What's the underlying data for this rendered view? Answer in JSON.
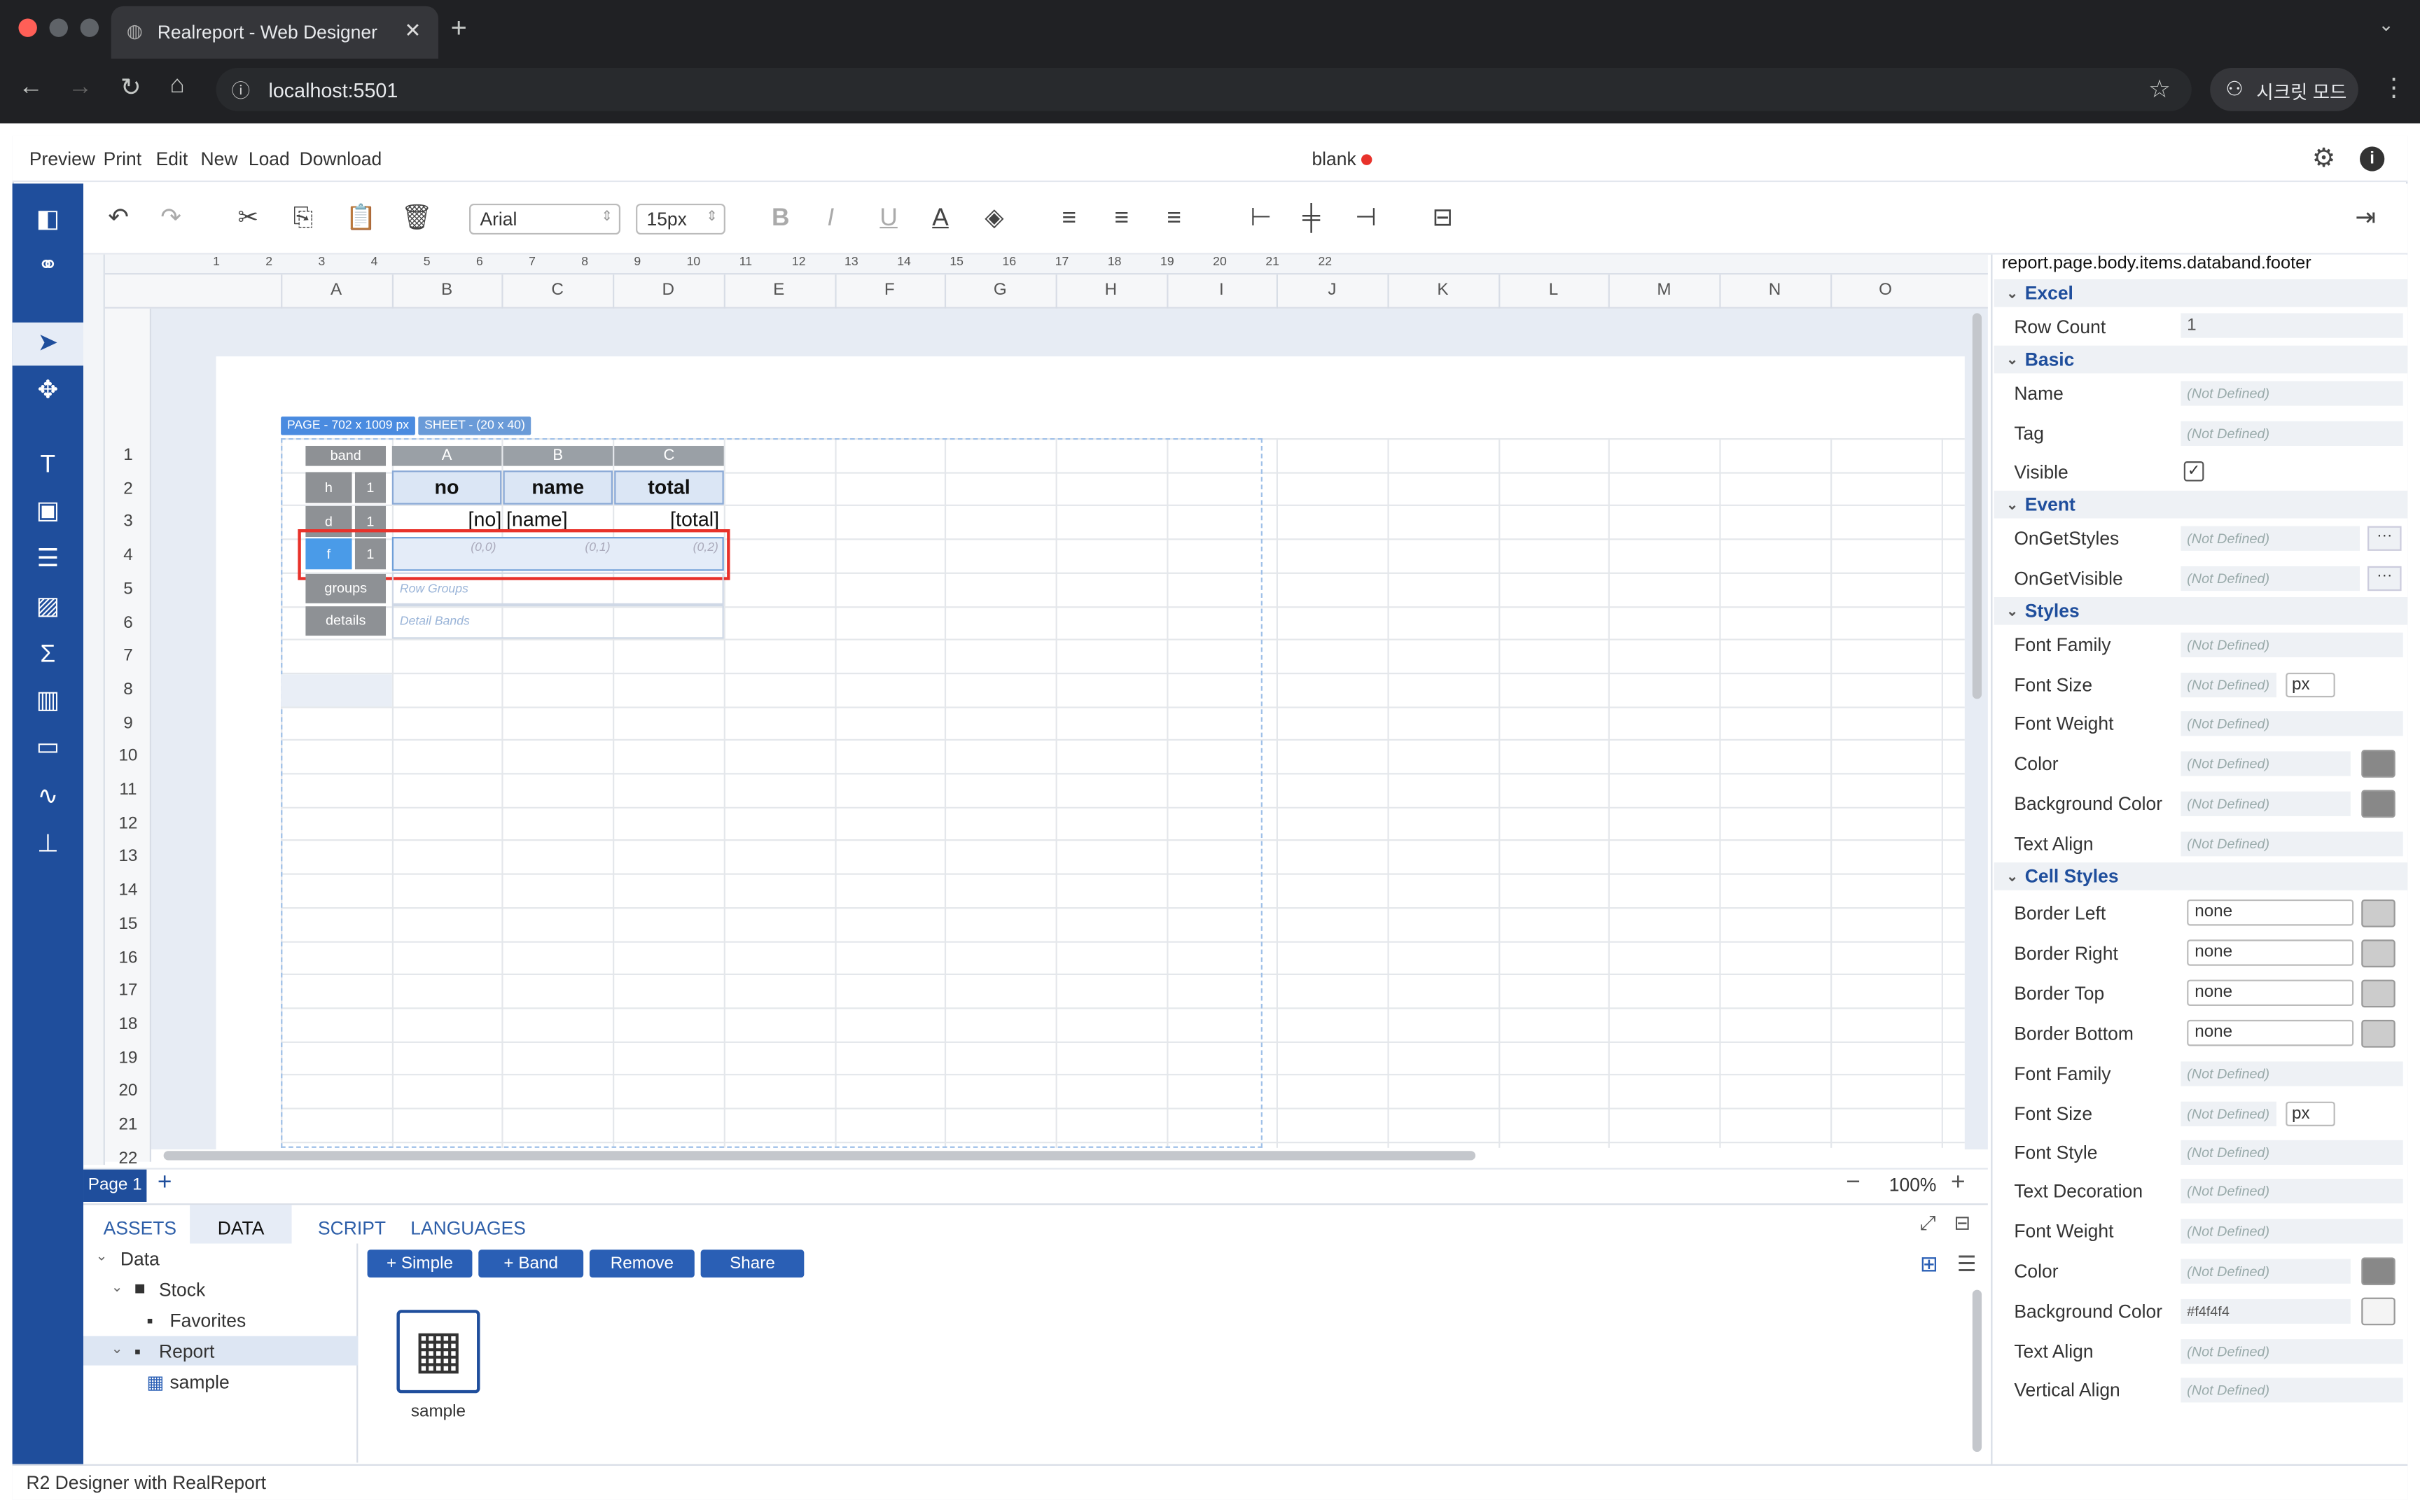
{
  "browser": {
    "tab_title": "Realreport - Web Designer",
    "url": "localhost:5501",
    "incognito_label": "시크릿 모드"
  },
  "menu": {
    "items": [
      "Preview",
      "Print",
      "Edit",
      "New",
      "Load",
      "Download"
    ],
    "doc_title": "blank"
  },
  "toolbar": {
    "font_family": "Arial",
    "font_size": "15px"
  },
  "ruler": {
    "marks": [
      "1",
      "2",
      "3",
      "4",
      "5",
      "6",
      "7",
      "8",
      "9",
      "10",
      "11",
      "12",
      "13",
      "14",
      "15",
      "16",
      "17",
      "18",
      "19",
      "20",
      "21",
      "22"
    ]
  },
  "sheet": {
    "columns": [
      "A",
      "B",
      "C",
      "D",
      "E",
      "F",
      "G",
      "H",
      "I",
      "J",
      "K",
      "L",
      "M",
      "N",
      "O"
    ],
    "rows": [
      "1",
      "2",
      "3",
      "4",
      "5",
      "6",
      "7",
      "8",
      "9",
      "10",
      "11",
      "12",
      "13",
      "14",
      "15",
      "16",
      "17",
      "18",
      "19",
      "20",
      "21",
      "22"
    ],
    "page_badge": "PAGE - 702 x 1009 px",
    "sheet_badge": "SHEET - (20 x 40)"
  },
  "band": {
    "header_label": "band",
    "cols": [
      "A",
      "B",
      "C"
    ],
    "header_cells": [
      "no",
      "name",
      "total"
    ],
    "detail_cells": [
      "[no]",
      "[name]",
      "[total]"
    ],
    "footer_coords": [
      "(0,0)",
      "(0,1)",
      "(0,2)"
    ],
    "row_labels": [
      {
        "k": "h",
        "n": "1"
      },
      {
        "k": "d",
        "n": "1"
      },
      {
        "k": "f",
        "n": "1"
      }
    ],
    "groups_label": "groups",
    "groups_hint": "Row Groups",
    "details_label": "details",
    "details_hint": "Detail Bands"
  },
  "pages": {
    "tab": "Page 1",
    "zoom": "100%"
  },
  "bottom": {
    "tabs": [
      "ASSETS",
      "DATA",
      "SCRIPT",
      "LANGUAGES"
    ],
    "active_tab": "DATA",
    "buttons": [
      "+ Simple",
      "+ Band",
      "Remove",
      "Share"
    ],
    "tree": [
      "Data",
      "Stock",
      "Favorites",
      "Report",
      "sample"
    ],
    "asset_label": "sample"
  },
  "panel": {
    "path": "report.page.body.items.databand.footer",
    "sections": {
      "excel": "Excel",
      "basic": "Basic",
      "event": "Event",
      "styles": "Styles",
      "cell_styles": "Cell Styles"
    },
    "row_count_label": "Row Count",
    "row_count_value": "1",
    "name_label": "Name",
    "tag_label": "Tag",
    "visible_label": "Visible",
    "on_get_styles": "OnGetStyles",
    "on_get_visible": "OnGetVisible",
    "not_defined": "(Not Defined)",
    "font_family": "Font Family",
    "font_size": "Font Size",
    "font_weight": "Font Weight",
    "color": "Color",
    "background_color": "Background Color",
    "text_align": "Text Align",
    "border_left": "Border Left",
    "border_right": "Border Right",
    "border_top": "Border Top",
    "border_bottom": "Border Bottom",
    "font_style": "Font Style",
    "text_decoration": "Text Decoration",
    "vertical_align": "Vertical Align",
    "none": "none",
    "px": "px",
    "bg_value": "#f4f4f4"
  },
  "status": {
    "text": "R2 Designer with RealReport"
  },
  "colors": {
    "accent": "#1f4e9c",
    "button": "#2a5fb5",
    "selection": "#e8322b"
  }
}
